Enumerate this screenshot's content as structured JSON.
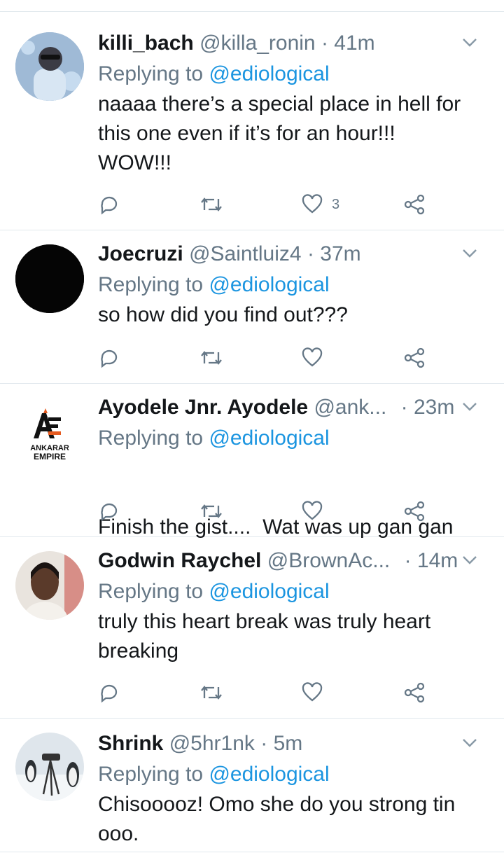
{
  "tweets": [
    {
      "name": "killi_bach",
      "handle": "@killa_ronin",
      "time": "41m",
      "replying_prefix": "Replying to",
      "replying_to": "@ediological",
      "text_lines": [
        "naaaa there’s a special place in hell for",
        "this one even if it’s for an hour!!!",
        "WOW!!!"
      ],
      "likes": "3"
    },
    {
      "name": "Joecruzi",
      "handle": "@Saintluiz4",
      "time": "37m",
      "replying_prefix": "Replying to",
      "replying_to": "@ediological",
      "text_lines": [
        "so how did you find out???"
      ],
      "likes": ""
    },
    {
      "name": "Ayodele Jnr. Ayodele",
      "handle": "@ank...",
      "time": "23m",
      "replying_prefix": "Replying to",
      "replying_to": "@ediological",
      "text_lines": [
        "Finish the gist....  Wat was up gan gan"
      ],
      "likes": "",
      "avatar_logo_lines": [
        "ANKARAR",
        "EMPIRE"
      ]
    },
    {
      "name": "Godwin Raychel",
      "handle": "@BrownAc...",
      "time": "14m",
      "replying_prefix": "Replying to",
      "replying_to": "@ediological",
      "text_lines": [
        "truly this heart break was truly heart",
        "breaking"
      ],
      "likes": ""
    },
    {
      "name": "Shrink",
      "handle": "@5hr1nk",
      "time": "5m",
      "replying_prefix": "Replying to",
      "replying_to": "@ediological",
      "text_lines": [
        "Chisooooz! Omo she do you strong tin",
        "ooo."
      ],
      "likes": ""
    }
  ],
  "separator": "·",
  "icons": [
    "reply-icon",
    "retweet-icon",
    "like-icon",
    "share-icon",
    "chevron-down-icon"
  ],
  "colors": {
    "mention": "#1b95e0",
    "secondary_text": "#657786",
    "divider": "#e1e8ed",
    "icon": "#657786"
  }
}
